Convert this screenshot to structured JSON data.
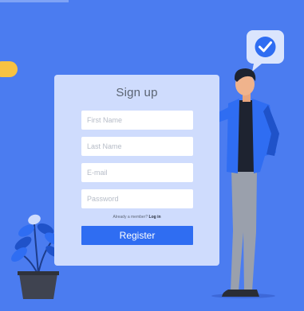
{
  "form": {
    "title": "Sign up",
    "first_name_placeholder": "First Name",
    "last_name_placeholder": "Last Name",
    "email_placeholder": "E-mail",
    "password_placeholder": "Password",
    "member_prompt": "Already a member?",
    "login_link": "Log in",
    "register_label": "Register"
  },
  "icons": {
    "speech_bubble": "check-speech-bubble-icon",
    "plant": "potted-plant",
    "person": "presenting-person"
  },
  "colors": {
    "background": "#4b7cf0",
    "card": "#cfdcfd",
    "button": "#2f6df2",
    "pill": "#f7c242"
  }
}
